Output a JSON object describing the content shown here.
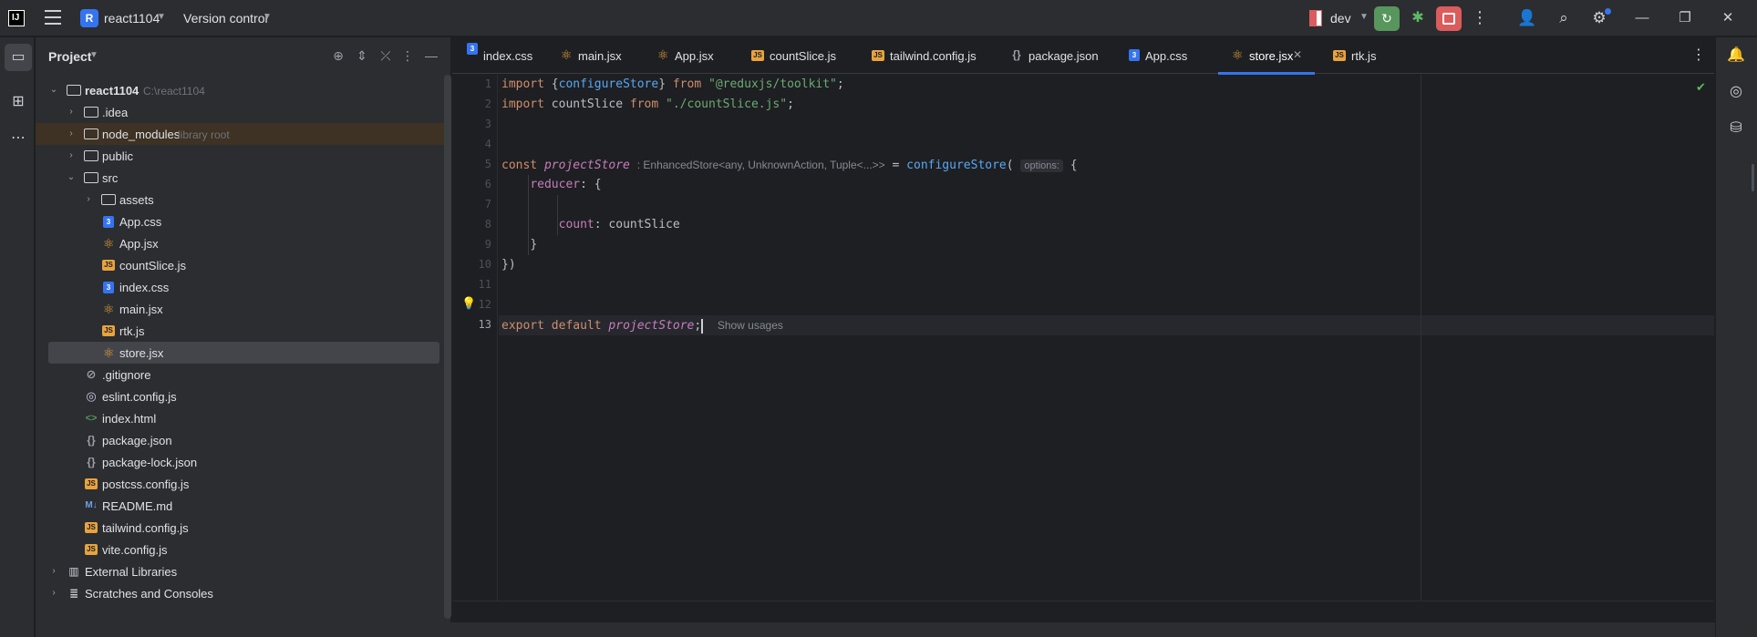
{
  "titlebar": {
    "project_badge": "R",
    "project_name": "react1104",
    "vcs_label": "Version control",
    "branch": "dev"
  },
  "project_panel": {
    "title": "Project"
  },
  "tree": [
    {
      "label": "react1104",
      "hint": "C:\\react1104"
    },
    {
      "label": ".idea"
    },
    {
      "label": "node_modules",
      "hint": "library root"
    },
    {
      "label": "public"
    },
    {
      "label": "src"
    },
    {
      "label": "assets"
    },
    {
      "label": "App.css"
    },
    {
      "label": "App.jsx"
    },
    {
      "label": "countSlice.js"
    },
    {
      "label": "index.css"
    },
    {
      "label": "main.jsx"
    },
    {
      "label": "rtk.js"
    },
    {
      "label": "store.jsx"
    },
    {
      "label": ".gitignore"
    },
    {
      "label": "eslint.config.js"
    },
    {
      "label": "index.html"
    },
    {
      "label": "package.json"
    },
    {
      "label": "package-lock.json"
    },
    {
      "label": "postcss.config.js"
    },
    {
      "label": "README.md"
    },
    {
      "label": "tailwind.config.js"
    },
    {
      "label": "vite.config.js"
    },
    {
      "label": "External Libraries"
    },
    {
      "label": "Scratches and Consoles"
    }
  ],
  "tabs": [
    {
      "label": "index.css",
      "icon": "css-file-icon"
    },
    {
      "label": "main.jsx",
      "icon": "react-file-icon"
    },
    {
      "label": "App.jsx",
      "icon": "react-file-icon"
    },
    {
      "label": "countSlice.js",
      "icon": "js-file-icon"
    },
    {
      "label": "tailwind.config.js",
      "icon": "js-file-icon"
    },
    {
      "label": "package.json",
      "icon": "json-file-icon"
    },
    {
      "label": "App.css",
      "icon": "css-file-icon"
    },
    {
      "label": "store.jsx",
      "icon": "react-file-icon",
      "active": true
    },
    {
      "label": "rtk.js",
      "icon": "js-file-icon"
    }
  ],
  "editor": {
    "line_numbers": [
      "1",
      "2",
      "3",
      "4",
      "5",
      "6",
      "7",
      "8",
      "9",
      "10",
      "11",
      "12",
      "13"
    ],
    "current_line": "13",
    "code": {
      "l1": {
        "kw": "import",
        "brace_open": " {",
        "fn": "configureStore",
        "brace_close": "} ",
        "from": "from",
        "str": "\"@reduxjs/toolkit\"",
        "end": ";"
      },
      "l2": {
        "kw": "import",
        "ident": " countSlice ",
        "from": "from",
        "str": "\"./countSlice.js\"",
        "end": ";"
      },
      "l5": {
        "kw": "const",
        "var": "projectStore",
        "type_hint": ": EnhancedStore<any, UnknownAction, Tuple<...>>",
        "eq": " = ",
        "fn": "configureStore",
        "paren": "(",
        "param_hint": "options:",
        "brace": " {"
      },
      "l6": {
        "prop": "reducer",
        "rest": ": {"
      },
      "l8": {
        "prop": "count",
        "rest": ": countSlice"
      },
      "l9": {
        "text": "}"
      },
      "l10": {
        "text": "})"
      },
      "l13": {
        "kw1": "export",
        "kw2": "default",
        "var": "projectStore",
        "end": ";",
        "usages": "Show usages"
      }
    }
  },
  "colors": {
    "accent": "#3574f0",
    "run": "#57965c",
    "stop": "#db5c5c",
    "keyword": "#cf8e6d",
    "string": "#6aab73",
    "function": "#56a8f5",
    "variable": "#c77dbb"
  }
}
